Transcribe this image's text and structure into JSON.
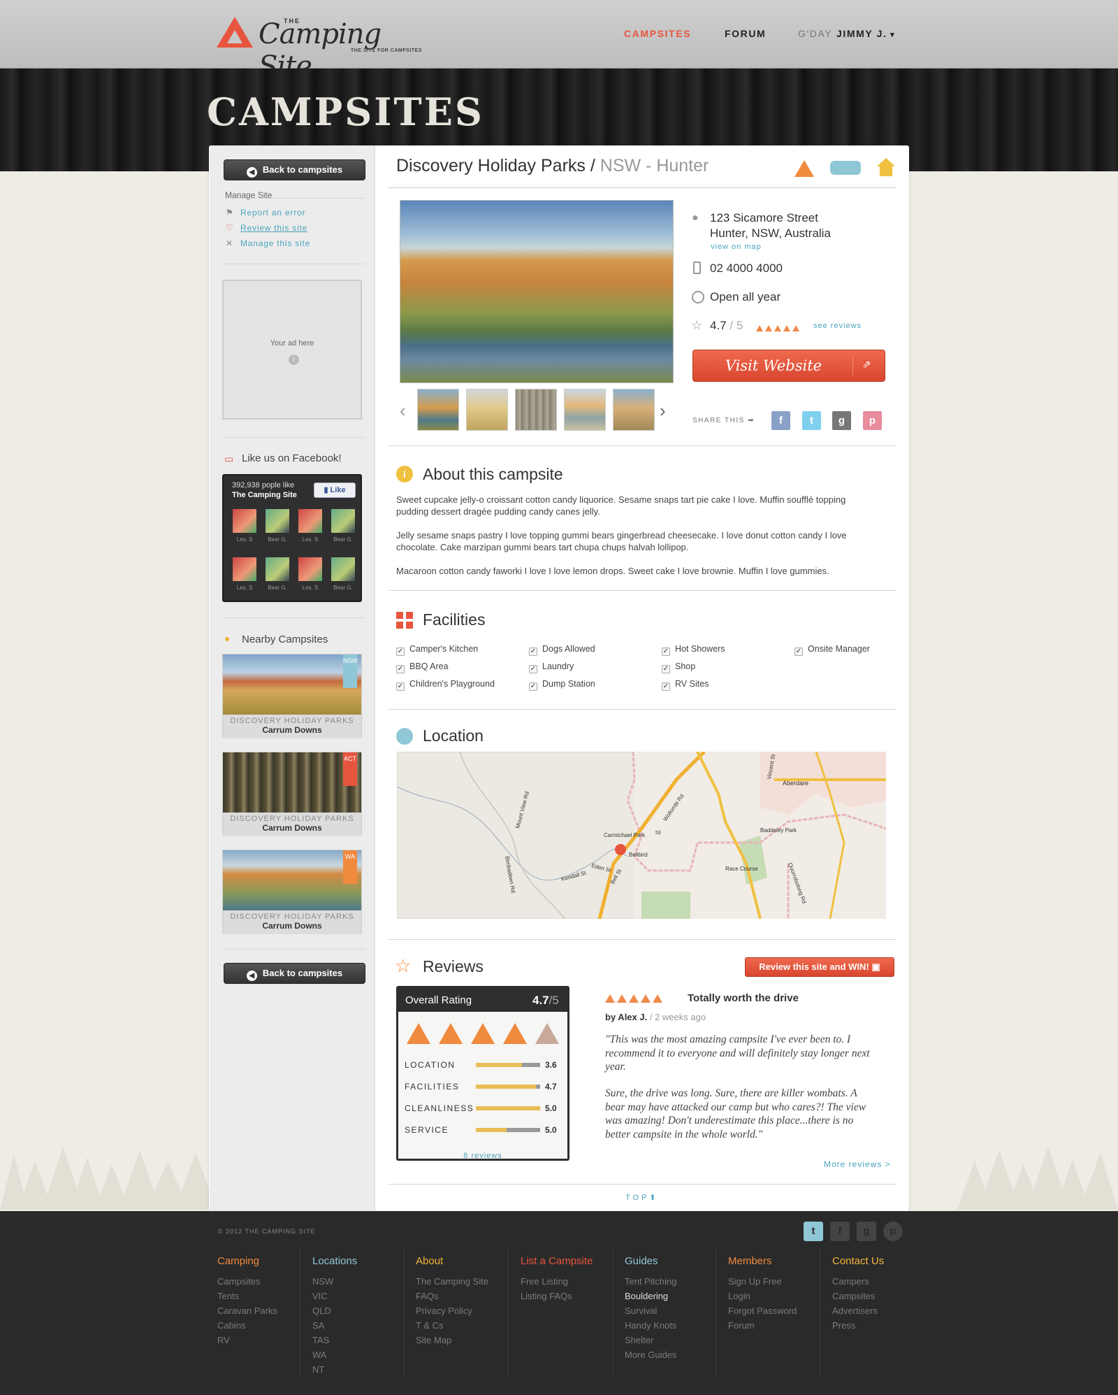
{
  "header": {
    "logo_the": "THE",
    "logo_name": "Camping Site",
    "logo_tagline": "THE SITE FOR CAMPSITES",
    "nav_campsites": "CAMPSITES",
    "nav_forum": "FORUM",
    "greeting": "G'DAY",
    "user": "JIMMY J."
  },
  "page_title": "CAMPSITES",
  "sidebar": {
    "back_label": "Back to campsites",
    "manage_heading": "Manage Site",
    "links": [
      "Report an error",
      "Review this site",
      "Manage this site"
    ],
    "ad_text": "Your ad here",
    "facebook_heading": "Like us on Facebook!",
    "fb_count": "392,938 pople like",
    "fb_page": "The Camping Site",
    "fb_like": "Like",
    "fb_names": [
      "Les. S",
      "Bear G.",
      "Les. S",
      "Bear G.",
      "Les. S",
      "Bear G.",
      "Les. S",
      "Bear G."
    ],
    "nearby_heading": "Nearby Campsites",
    "nearby": [
      {
        "name": "DISCOVERY HOLIDAY PARKS",
        "place": "Carrum Downs",
        "state": "NSW"
      },
      {
        "name": "DISCOVERY HOLIDAY PARKS",
        "place": "Carrum Downs",
        "state": "ACT"
      },
      {
        "name": "DISCOVERY HOLIDAY PARKS",
        "place": "Carrum Downs",
        "state": "WA"
      }
    ]
  },
  "site": {
    "name": "Discovery Holiday Parks",
    "separator": "/",
    "region": "NSW - Hunter",
    "address1": "123 Sicamore Street",
    "address2": "Hunter, NSW, Australia",
    "view_map": "view on map",
    "phone": "02 4000 4000",
    "hours": "Open all year",
    "rating": "4.7",
    "rating_max": "/ 5",
    "see_reviews": "see reviews",
    "visit_label": "Visit Website",
    "share_label": "SHARE THIS ➡"
  },
  "about": {
    "heading": "About this campsite",
    "paragraphs": [
      "Sweet cupcake jelly-o croissant cotton candy liquorice. Sesame snaps tart pie cake I love. Muffin soufflé topping pudding dessert dragée pudding candy canes jelly.",
      "Jelly sesame snaps pastry I love topping gummi bears gingerbread cheesecake. I love donut cotton candy I love chocolate. Cake marzipan gummi bears tart chupa chups halvah lollipop.",
      "Macaroon cotton candy faworki I love I love lemon drops. Sweet cake I love brownie. Muffin I love gummies."
    ]
  },
  "facilities": {
    "heading": "Facilities",
    "items": [
      "Camper's Kitchen",
      "BBQ Area",
      "Children's Playground",
      "Dogs Allowed",
      "Laundry",
      "Dump Station",
      "Hot Showers",
      "Shop",
      "RV Sites",
      "Onsite Manager"
    ]
  },
  "location": {
    "heading": "Location",
    "map_labels": [
      "Aberdare",
      "Vincent St",
      "Wollombi Rd",
      "Mount View Rd",
      "Carmichael Park",
      "Bellbird",
      "Eden St",
      "Kendall St",
      "Bell St",
      "Baddeley Park",
      "Race Course",
      "Quorrobolong Rd",
      "Bimbadeen Rd",
      "53"
    ]
  },
  "reviews": {
    "heading": "Reviews",
    "cta": "Review this site and WIN!",
    "overall_label": "Overall Rating",
    "overall_value": "4.7",
    "overall_max": "/5",
    "categories": [
      {
        "label": "LOCATION",
        "value": "3.6",
        "fill": 0.72
      },
      {
        "label": "FACILITIES",
        "value": "4.7",
        "fill": 0.94
      },
      {
        "label": "CLEANLINESS",
        "value": "5.0",
        "fill": 1.0
      },
      {
        "label": "SERVICE",
        "value": "5.0",
        "fill": 0.48
      }
    ],
    "count_link": "8 reviews",
    "review_title": "Totally worth the drive",
    "review_by": "by Alex J.",
    "review_when": "/  2 weeks ago",
    "review_p1": "\"This was the most amazing campsite I've ever been to. I recommend it to everyone and will definitely stay longer next year.",
    "review_p2": "Sure, the drive was long. Sure, there are killer wombats. A bear may have attacked our camp but who cares?! The view was amazing! Don't underestimate this place...there is no better campsite in the whole world.\"",
    "more": "More reviews >",
    "top": "TOP"
  },
  "footer": {
    "copyright": "© 2012 THE CAMPING SITE",
    "columns": [
      {
        "title": "Camping",
        "links": [
          "Campsites",
          "Tents",
          "Caravan Parks",
          "Cabins",
          "RV"
        ]
      },
      {
        "title": "Locations",
        "links": [
          "NSW",
          "VIC",
          "QLD",
          "SA",
          "TAS",
          "WA",
          "NT"
        ]
      },
      {
        "title": "About",
        "links": [
          "The Camping Site",
          "FAQs",
          "Privacy Policy",
          "T & Cs",
          "Site Map"
        ]
      },
      {
        "title": "List a Campsite",
        "links": [
          "Free Listing",
          "Listing FAQs"
        ]
      },
      {
        "title": "Guides",
        "links": [
          "Tent Pitching",
          "Bouldering",
          "Survival",
          "Handy Knots",
          "Shelter",
          "More Guides"
        ]
      },
      {
        "title": "Members",
        "links": [
          "Sign Up Free",
          "Login",
          "Forgot Password",
          "Forum"
        ]
      },
      {
        "title": "Contact Us",
        "links": [
          "Campers",
          "Campsites",
          "Advertisers",
          "Press"
        ]
      }
    ]
  },
  "colors": {
    "accent": "#e8553e",
    "link": "#4aa3bd",
    "footer_bg": "#2a2a2a"
  }
}
